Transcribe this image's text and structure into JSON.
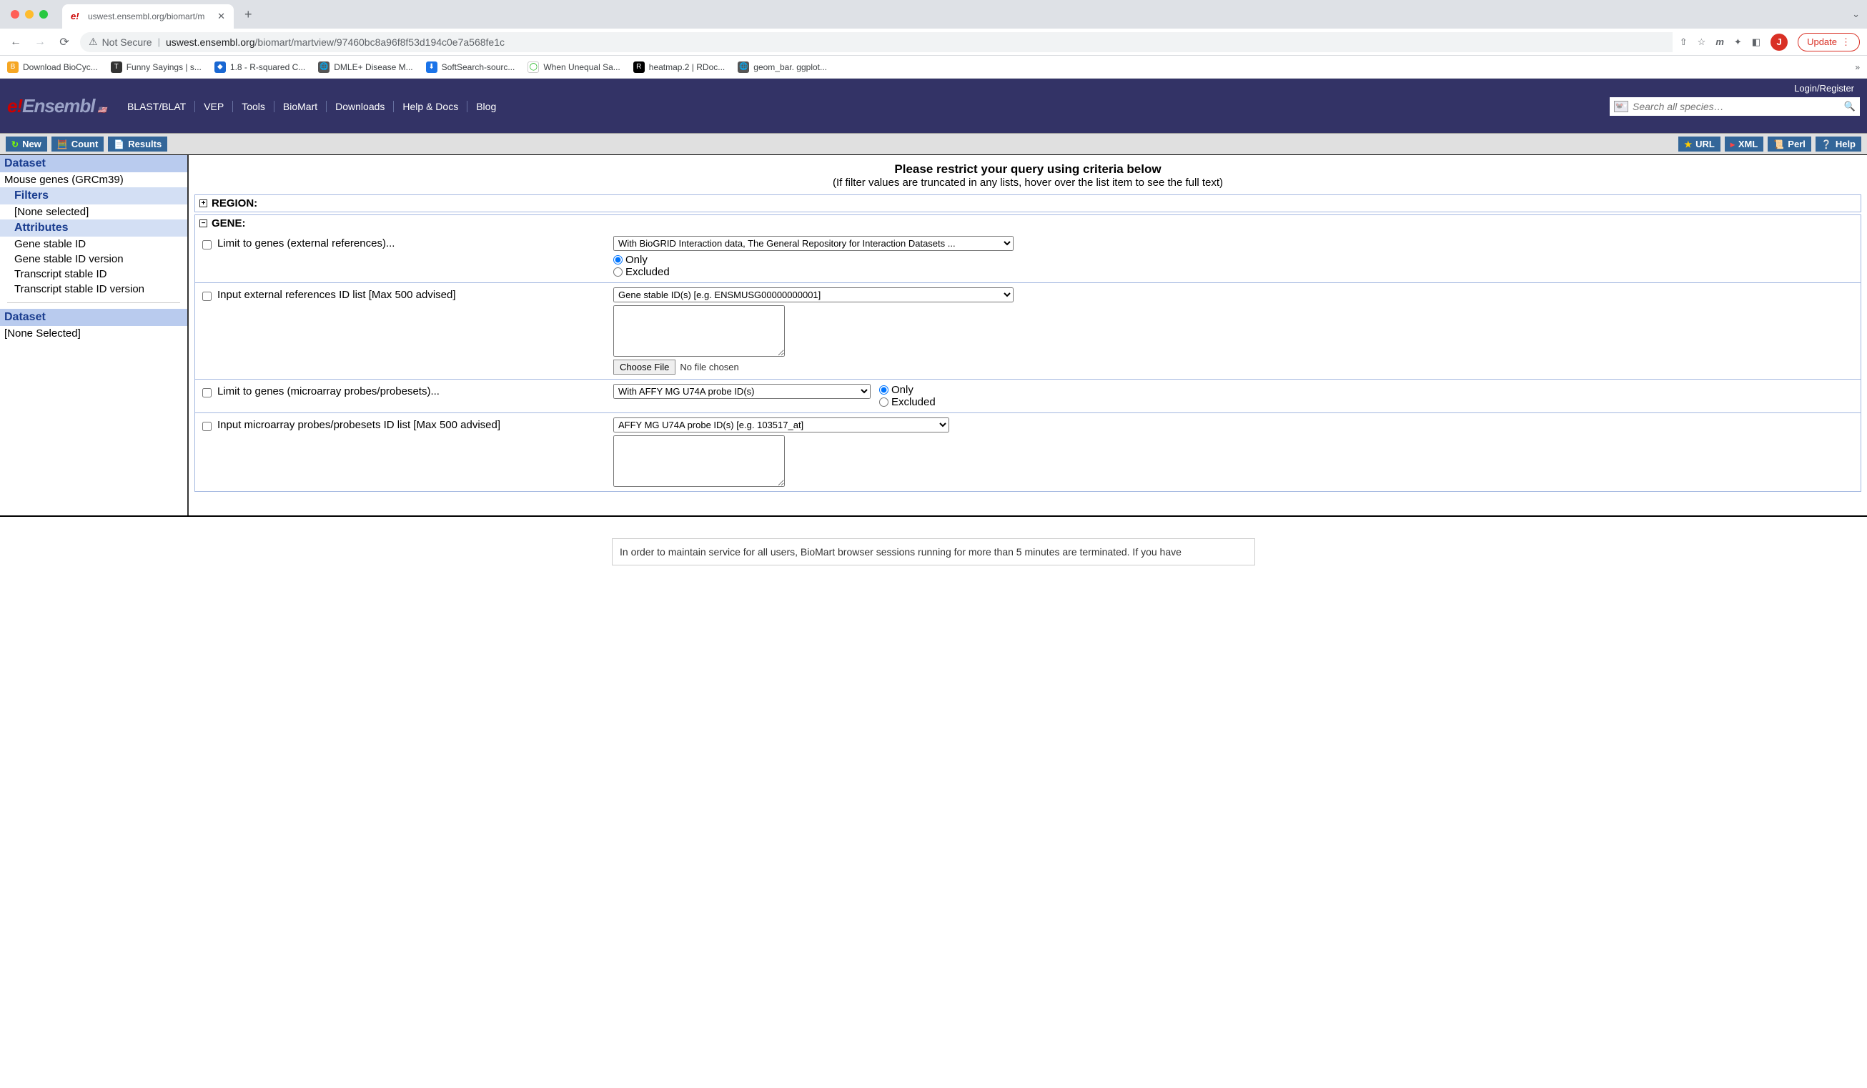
{
  "browser": {
    "tab_title": "uswest.ensembl.org/biomart/m",
    "not_secure": "Not Secure",
    "url_host": "uswest.ensembl.org",
    "url_path": "/biomart/martview/97460bc8a96f8f53d194c0e7a568fe1c",
    "update_label": "Update",
    "profile_initial": "J",
    "bookmarks": [
      "Download BioCyc...",
      "Funny Sayings | s...",
      "1.8 - R-squared C...",
      "DMLE+ Disease M...",
      "SoftSearch-sourc...",
      "When Unequal Sa...",
      "heatmap.2 | RDoc...",
      "geom_bar. ggplot..."
    ]
  },
  "ensembl": {
    "login": "Login/Register",
    "nav": [
      "BLAST/BLAT",
      "VEP",
      "Tools",
      "BioMart",
      "Downloads",
      "Help & Docs",
      "Blog"
    ],
    "search_placeholder": "Search all species…"
  },
  "toolbar": {
    "new": "New",
    "count": "Count",
    "results": "Results",
    "url": "URL",
    "xml": "XML",
    "perl": "Perl",
    "help": "Help"
  },
  "sidebar": {
    "dataset_header": "Dataset",
    "dataset_value": "Mouse genes (GRCm39)",
    "filters_header": "Filters",
    "filters_value": "[None selected]",
    "attributes_header": "Attributes",
    "attributes": [
      "Gene stable ID",
      "Gene stable ID version",
      "Transcript stable ID",
      "Transcript stable ID version"
    ],
    "dataset2_header": "Dataset",
    "dataset2_value": "[None Selected]"
  },
  "content": {
    "heading": "Please restrict your query using criteria below",
    "subheading": "(If filter values are truncated in any lists, hover over the list item to see the full text)",
    "sections": {
      "region": "REGION:",
      "gene": "GENE:"
    },
    "filters": {
      "limit_ext_label": "Limit to genes (external references)...",
      "limit_ext_select": "With BioGRID Interaction data, The General Repository for Interaction Datasets ...",
      "only": "Only",
      "excluded": "Excluded",
      "input_ext_label": "Input external references ID list [Max 500 advised]",
      "input_ext_select": "Gene stable ID(s) [e.g. ENSMUSG00000000001]",
      "choose_file": "Choose File",
      "no_file": "No file chosen",
      "limit_micro_label": "Limit to genes (microarray probes/probesets)...",
      "limit_micro_select": "With AFFY MG U74A probe ID(s)",
      "input_micro_label": "Input microarray probes/probesets ID list [Max 500 advised]",
      "input_micro_select": "AFFY MG U74A probe ID(s) [e.g. 103517_at]"
    },
    "footer_note": "In order to maintain service for all users, BioMart browser sessions running for more than 5 minutes are terminated. If you have"
  }
}
